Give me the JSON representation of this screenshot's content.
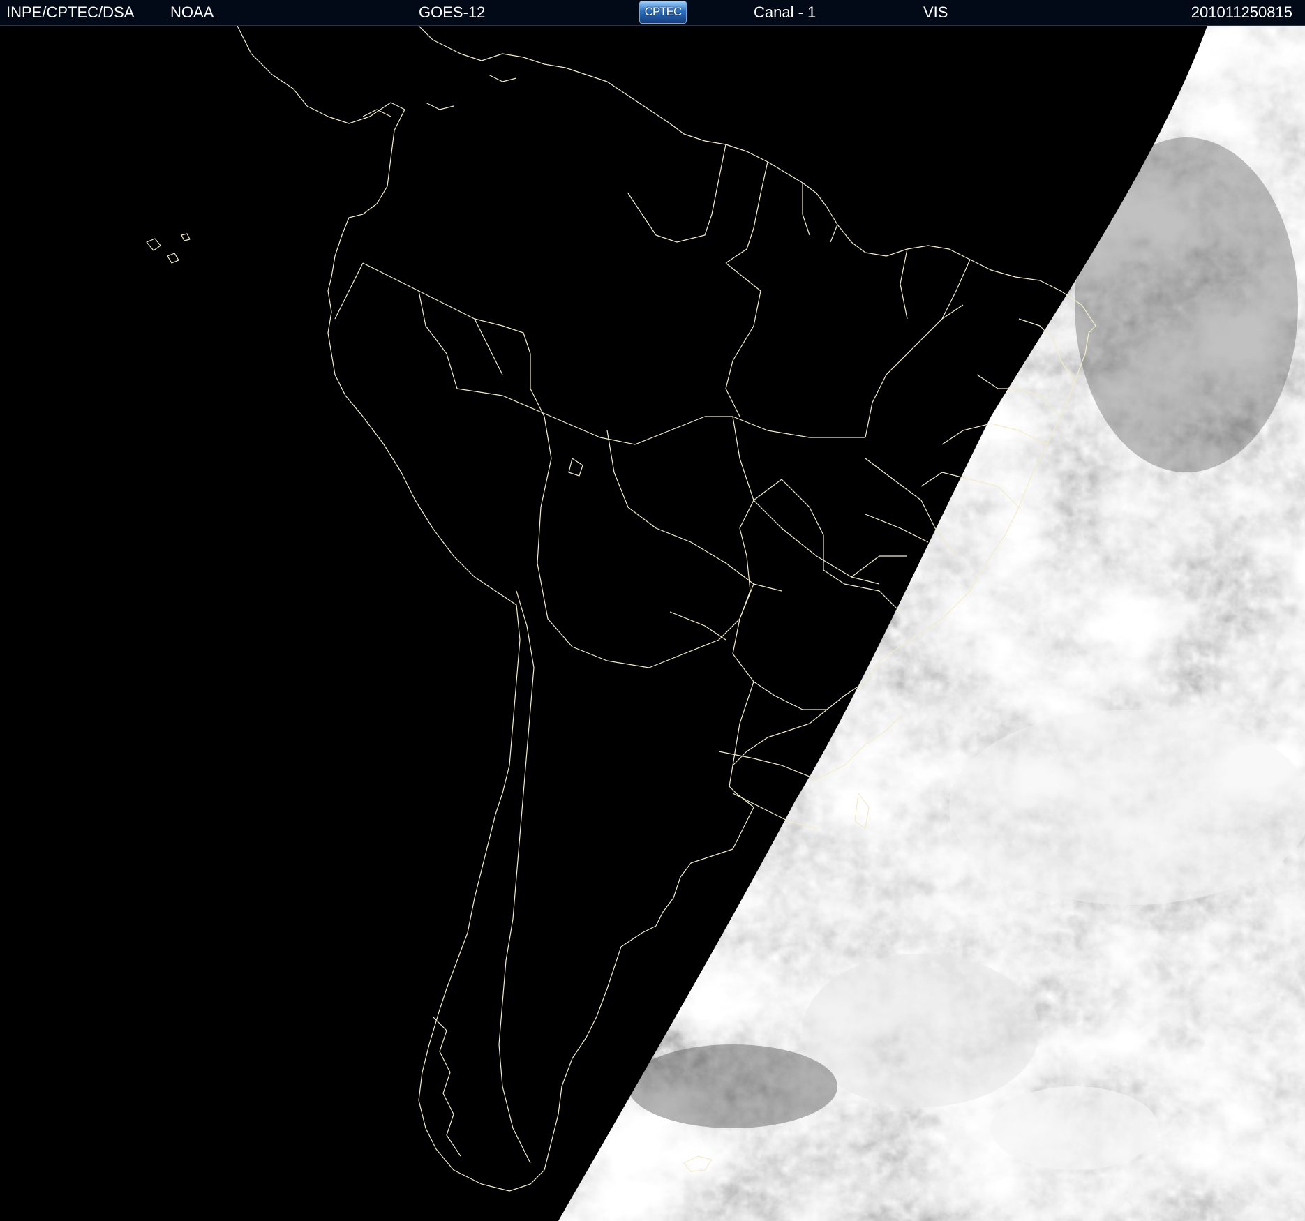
{
  "header": {
    "agency": "INPE/CPTEC/DSA",
    "organization": "NOAA",
    "satellite": "GOES-12",
    "logo_text": "CPTEC",
    "channel": "Canal - 1",
    "band": "VIS",
    "timestamp": "201011250815"
  },
  "map": {
    "view": "satellite visible-channel image",
    "coastline_color": "#f2edc8",
    "background_color": "#000000",
    "cloud_color": "#cfcfcf"
  }
}
